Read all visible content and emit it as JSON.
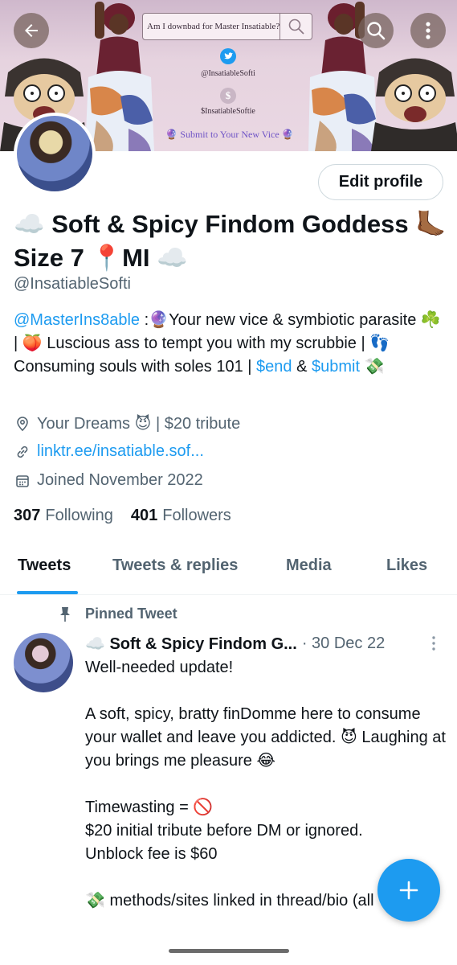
{
  "banner": {
    "search_text": "Am I downbad for Master Insatiable?",
    "twitter_handle": "@InsatiableSofti",
    "cashapp_handle": "$InsatiableSoftie",
    "cta": "🔮 Submit to Your New Vice 🔮"
  },
  "nav": {
    "back_icon": "arrow-left-icon",
    "search_icon": "search-icon",
    "more_icon": "more-vertical-icon"
  },
  "profile": {
    "edit_button": "Edit profile",
    "name": "☁️ Soft & Spicy Findom Goddess 🦶🏾 Size 7 📍MI ☁️",
    "handle": "@InsatiableSofti",
    "bio": {
      "mention": "@MasterIns8able",
      "part1": " :🔮Your new vice & symbiotic parasite ☘️ | 🍑 Luscious ass to tempt you with my scrubbie | 👣 Consuming souls with soles 101 | ",
      "link_end": "$end",
      "part2": " & ",
      "link_submit": "$ubmit",
      "part3": " 💸"
    },
    "location": "Your Dreams 😈 | $20 tribute",
    "website": "linktr.ee/insatiable.sof...",
    "joined": "Joined November 2022",
    "following_count": "307",
    "following_label": "Following",
    "followers_count": "401",
    "followers_label": "Followers"
  },
  "tabs": [
    "Tweets",
    "Tweets & replies",
    "Media",
    "Likes"
  ],
  "pinned_tweet": {
    "label": "Pinned Tweet",
    "author": "☁️ Soft & Spicy Findom G...",
    "date": "· 30 Dec 22",
    "lines": [
      "Well-needed update!",
      "",
      "A soft, spicy, bratty finDomme here to consume your wallet and leave you addicted. 😈 Laughing at you brings me pleasure 😂",
      "",
      "Timewasting = 🚫",
      "$20 initial tribute before DM or ignored.",
      "Unblock fee is $60",
      "",
      "💸 methods/sites linked in thread/bio (all verified)"
    ]
  },
  "colors": {
    "accent": "#1d9bf0",
    "text_primary": "#0f1419",
    "text_secondary": "#536471"
  }
}
